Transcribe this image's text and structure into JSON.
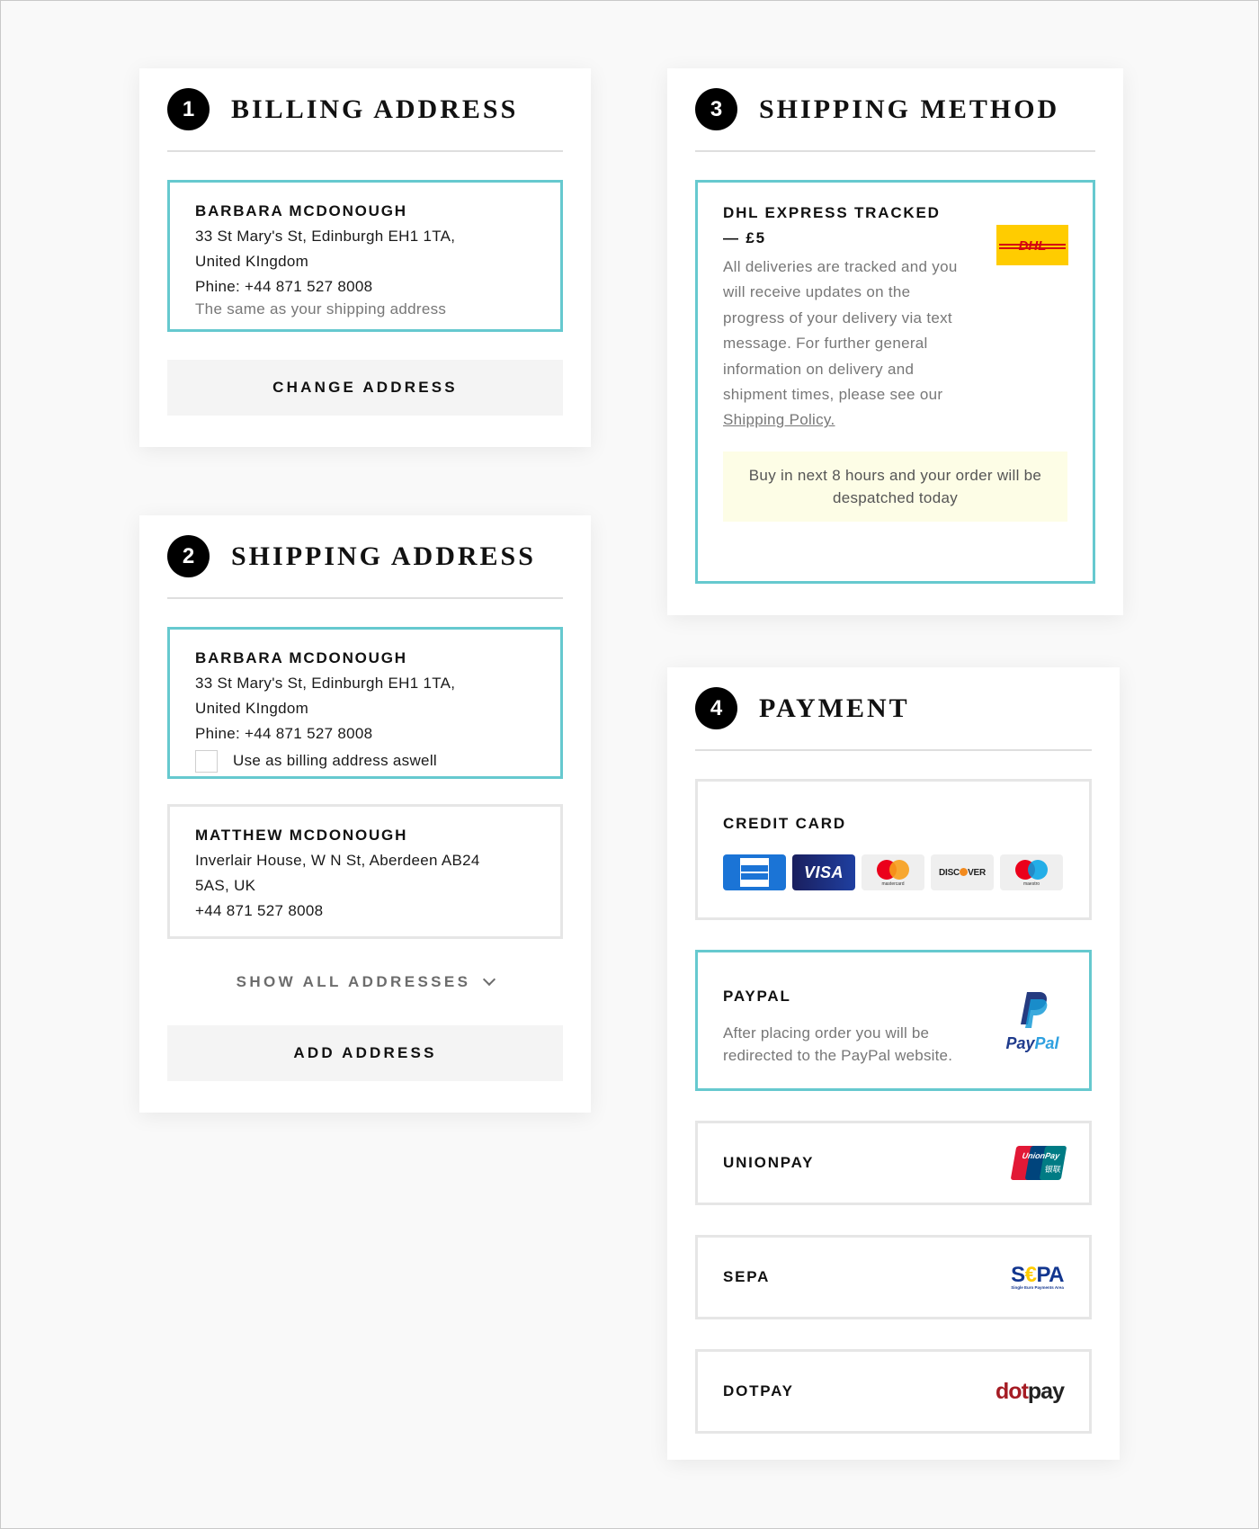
{
  "billing": {
    "step": "1",
    "title": "BILLING ADDRESS",
    "address": {
      "name": "BARBARA MCDONOUGH",
      "line1": "33 St Mary's St, Edinburgh EH1 1TA,",
      "line2": "United KIngdom",
      "phone": "Phine: +44 871 527 8008",
      "note": "The same as your shipping address"
    },
    "button": "CHANGE ADDRESS"
  },
  "shipping_address": {
    "step": "2",
    "title": "SHIPPING ADDRESS",
    "addresses": [
      {
        "name": "BARBARA MCDONOUGH",
        "line1": "33 St Mary's St, Edinburgh EH1 1TA,",
        "line2": "United KIngdom",
        "phone": "Phine: +44 871 527 8008",
        "checkbox_label": "Use as billing address aswell",
        "checkbox_checked": false,
        "selected": true
      },
      {
        "name": "MATTHEW MCDONOUGH",
        "line1": "Inverlair House, W N St, Aberdeen AB24",
        "line2": "5AS, UK",
        "phone": "+44 871 527 8008",
        "selected": false
      }
    ],
    "show_all": "SHOW ALL ADDRESSES",
    "button": "ADD ADDRESS"
  },
  "shipping_method": {
    "step": "3",
    "title": "SHIPPING METHOD",
    "option": {
      "name": "DHL EXPRESS TRACKED",
      "price": "— £5",
      "description": "All deliveries are tracked and you will receive updates on the progress of your delivery via text message. For further general information on delivery and shipment times, please see our",
      "link": "Shipping Policy.",
      "logo": "DHL",
      "notice": "Buy in next 8 hours and your order will be despatched today"
    }
  },
  "payment": {
    "step": "4",
    "title": "PAYMENT",
    "options": {
      "credit_card": {
        "label": "CREDIT CARD",
        "cards": {
          "amex": "AMERICAN EXPRESS",
          "visa": "VISA",
          "mastercard": "mastercard",
          "discover_a": "DISC",
          "discover_b": "VER",
          "maestro": "maestro"
        }
      },
      "paypal": {
        "label": "PAYPAL",
        "description": "After placing order you will be redirected to the PayPal website.",
        "logo_a": "Pay",
        "logo_b": "Pal"
      },
      "unionpay": {
        "label": "UNIONPAY",
        "logo": "UnionPay",
        "logo_cn": "银联"
      },
      "sepa": {
        "label": "SEPA",
        "logo_a": "S",
        "logo_b": "€",
        "logo_c": "PA",
        "logo_sub": "Single Euro Payments Area"
      },
      "dotpay": {
        "label": "DOTPAY",
        "logo_a": "dot",
        "logo_b": "pay"
      }
    }
  },
  "colors": {
    "selected_border": "#66c9cf",
    "default_border": "#e6e6e6",
    "notice_bg": "#fdfde6",
    "button_bg": "#f4f4f4"
  }
}
